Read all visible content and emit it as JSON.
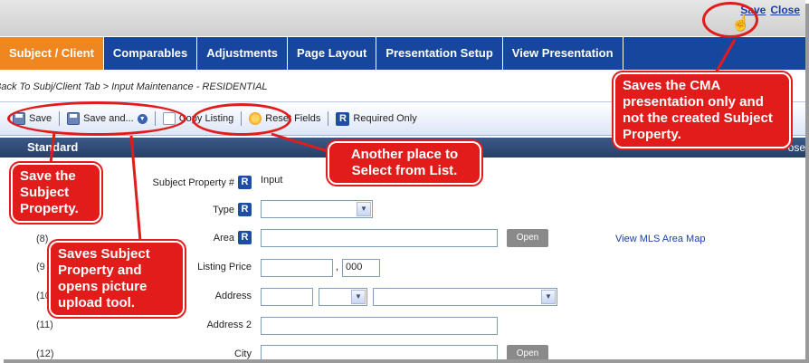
{
  "top_actions": {
    "save": "Save",
    "close": "Close"
  },
  "tabs": [
    {
      "label": "Subject / Client",
      "active": true
    },
    {
      "label": "Comparables",
      "active": false
    },
    {
      "label": "Adjustments",
      "active": false
    },
    {
      "label": "Page Layout",
      "active": false
    },
    {
      "label": "Presentation Setup",
      "active": false
    },
    {
      "label": "View Presentation",
      "active": false
    }
  ],
  "breadcrumb": "Back To Subj/Client Tab > Input Maintenance - RESIDENTIAL",
  "toolbar": {
    "save": "Save",
    "save_and": "Save and...",
    "copy_listing": "Copy Listing",
    "reset_fields": "Reset Fields",
    "required_only": "Required Only",
    "required_badge": "R"
  },
  "section": {
    "title": "Standard",
    "close": "ose"
  },
  "form": {
    "subject_property_label": "Subject Property #",
    "subject_property_value": "Input",
    "type_label": "Type",
    "row_8": "(8)",
    "area_label": "Area",
    "open_button": "Open",
    "mls_map_link": "View MLS Area Map",
    "row_9": "(9",
    "listing_price_label": "Listing Price",
    "price_separator": ",",
    "price_suffix": "000",
    "row_10": "(10",
    "address_label": "Address",
    "row_11": "(11)",
    "address2_label": "Address 2",
    "row_12": "(12)",
    "city_label": "City",
    "city_open_button": "Open",
    "r_badge": "R"
  },
  "callouts": {
    "save_cma": "Saves the CMA presentation only and not the created Subject Property.",
    "another_place": "Another place to Select from List.",
    "save_subject": "Save the Subject Property.",
    "saves_subject_opens": "Saves Subject Property and opens picture upload tool."
  },
  "colors": {
    "accent_orange": "#f0861f",
    "tab_blue": "#16469e",
    "callout_red": "#e21b1b"
  }
}
